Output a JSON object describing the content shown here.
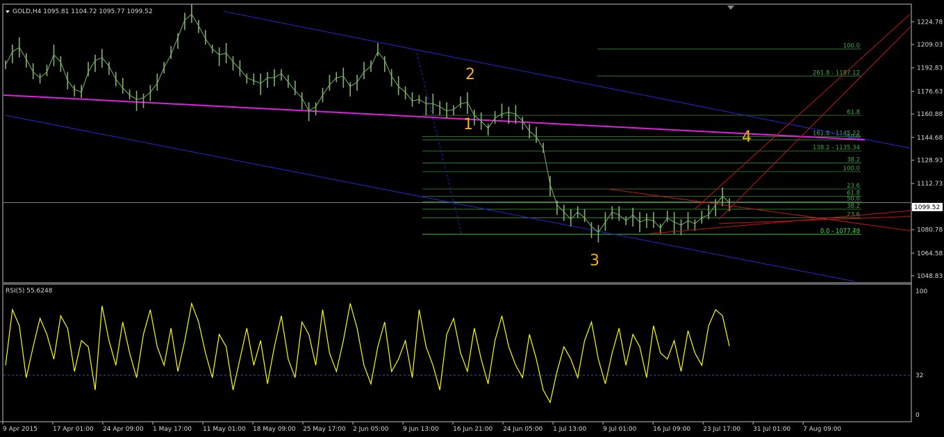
{
  "header": {
    "symbol_line": "GOLD,H4  1095.81 1104.72 1095.77 1099.52",
    "rsi_label": "RSI(5) 55.6248"
  },
  "colors": {
    "background": "#000000",
    "frame": "#bfbfbf",
    "candles": "#7fb56a",
    "rsi_line": "#ffff00",
    "channel": "#2626d9",
    "trendline": "#e020e0",
    "fib": "#2f8f2f",
    "wave_labels": "#f0b020",
    "pitchfork": "#c81414"
  },
  "wave_labels": [
    "1",
    "2",
    "3",
    "4"
  ],
  "chart_data": [
    {
      "type": "line",
      "series": [
        {
          "name": "GOLD,H4",
          "values": [
            1195,
            1204,
            1207,
            1199,
            1190,
            1186,
            1190,
            1202,
            1197,
            1184,
            1178,
            1176,
            1190,
            1198,
            1200,
            1194,
            1185,
            1179,
            1174,
            1171,
            1172,
            1176,
            1182,
            1193,
            1202,
            1214,
            1226,
            1230,
            1222,
            1213,
            1206,
            1202,
            1203,
            1197,
            1192,
            1186,
            1184,
            1182,
            1186,
            1186,
            1189,
            1183,
            1177,
            1172,
            1163,
            1166,
            1174,
            1181,
            1186,
            1187,
            1180,
            1183,
            1190,
            1194,
            1204,
            1198,
            1187,
            1180,
            1176,
            1170,
            1171,
            1168,
            1168,
            1166,
            1163,
            1164,
            1168,
            1169,
            1160,
            1156,
            1151,
            1158,
            1161,
            1162,
            1161,
            1156,
            1149,
            1145,
            1137,
            1112,
            1098,
            1093,
            1088,
            1093,
            1089,
            1083,
            1079,
            1086,
            1093,
            1091,
            1087,
            1091,
            1086,
            1088,
            1087,
            1082,
            1089,
            1086,
            1084,
            1087,
            1085,
            1089,
            1091,
            1098,
            1104,
            1099.52
          ]
        }
      ],
      "x_tick_labels": [
        "9 Apr 2015",
        "17 Apr 01:00",
        "24 Apr 09:00",
        "1 May 17:00",
        "11 May 01:00",
        "18 May 09:00",
        "25 May 17:00",
        "2 Jun 05:00",
        "9 Jun 13:00",
        "16 Jun 21:00",
        "24 Jun 05:00",
        "1 Jul 13:00",
        "9 Jul 01:00",
        "16 Jul 09:00",
        "23 Jul 17:00",
        "31 Jul 01:00",
        "7 Aug 09:00"
      ],
      "y_tick_labels": [
        "1224.78",
        "1209.03",
        "1192.83",
        "1176.63",
        "1160.88",
        "1144.68",
        "1128.93",
        "1112.73",
        "1096.53",
        "1080.78",
        "1064.58",
        "1048.83"
      ],
      "ylim": [
        1045,
        1236
      ],
      "current_price": "1099.52",
      "fib_levels": [
        {
          "label": "100.0",
          "price": 1206
        },
        {
          "label": "261.8 - 1187.12",
          "price": 1187.12
        },
        {
          "label": "61.8",
          "price": 1160
        },
        {
          "label": "161.8 - 1145.22",
          "price": 1145.22
        },
        {
          "label": "50.0",
          "price": 1143
        },
        {
          "label": "138.2 - 1135.34",
          "price": 1135.34
        },
        {
          "label": "38.2",
          "price": 1127
        },
        {
          "label": "100.0",
          "price": 1121
        },
        {
          "label": "23.6",
          "price": 1109
        },
        {
          "label": "61.8",
          "price": 1104
        },
        {
          "label": "50.0",
          "price": 1100
        },
        {
          "label": "38.2",
          "price": 1095
        },
        {
          "label": "23.6",
          "price": 1089
        },
        {
          "label": "0.0 - 1077.70",
          "price": 1077.7
        },
        {
          "label": "0.0 - 1077.43",
          "price": 1077.43
        }
      ]
    },
    {
      "type": "line",
      "series": [
        {
          "name": "RSI(5)",
          "values": [
            40,
            85,
            72,
            30,
            55,
            78,
            65,
            45,
            80,
            70,
            35,
            60,
            55,
            20,
            88,
            60,
            40,
            75,
            50,
            30,
            65,
            85,
            55,
            40,
            70,
            35,
            60,
            90,
            75,
            50,
            30,
            65,
            55,
            20,
            45,
            70,
            40,
            60,
            25,
            55,
            80,
            45,
            30,
            75,
            65,
            40,
            85,
            50,
            35,
            60,
            90,
            70,
            40,
            25,
            55,
            75,
            35,
            45,
            60,
            30,
            85,
            55,
            40,
            20,
            65,
            78,
            50,
            35,
            70,
            45,
            25,
            60,
            80,
            55,
            40,
            30,
            65,
            45,
            20,
            10,
            35,
            55,
            45,
            30,
            60,
            75,
            45,
            25,
            50,
            70,
            40,
            65,
            55,
            30,
            72,
            50,
            45,
            60,
            35,
            68,
            50,
            40,
            72,
            85,
            80,
            55.6248
          ]
        }
      ],
      "y_tick_labels": [
        "100",
        "32",
        "0"
      ],
      "ylim": [
        0,
        100
      ],
      "reference_level": 32
    }
  ]
}
